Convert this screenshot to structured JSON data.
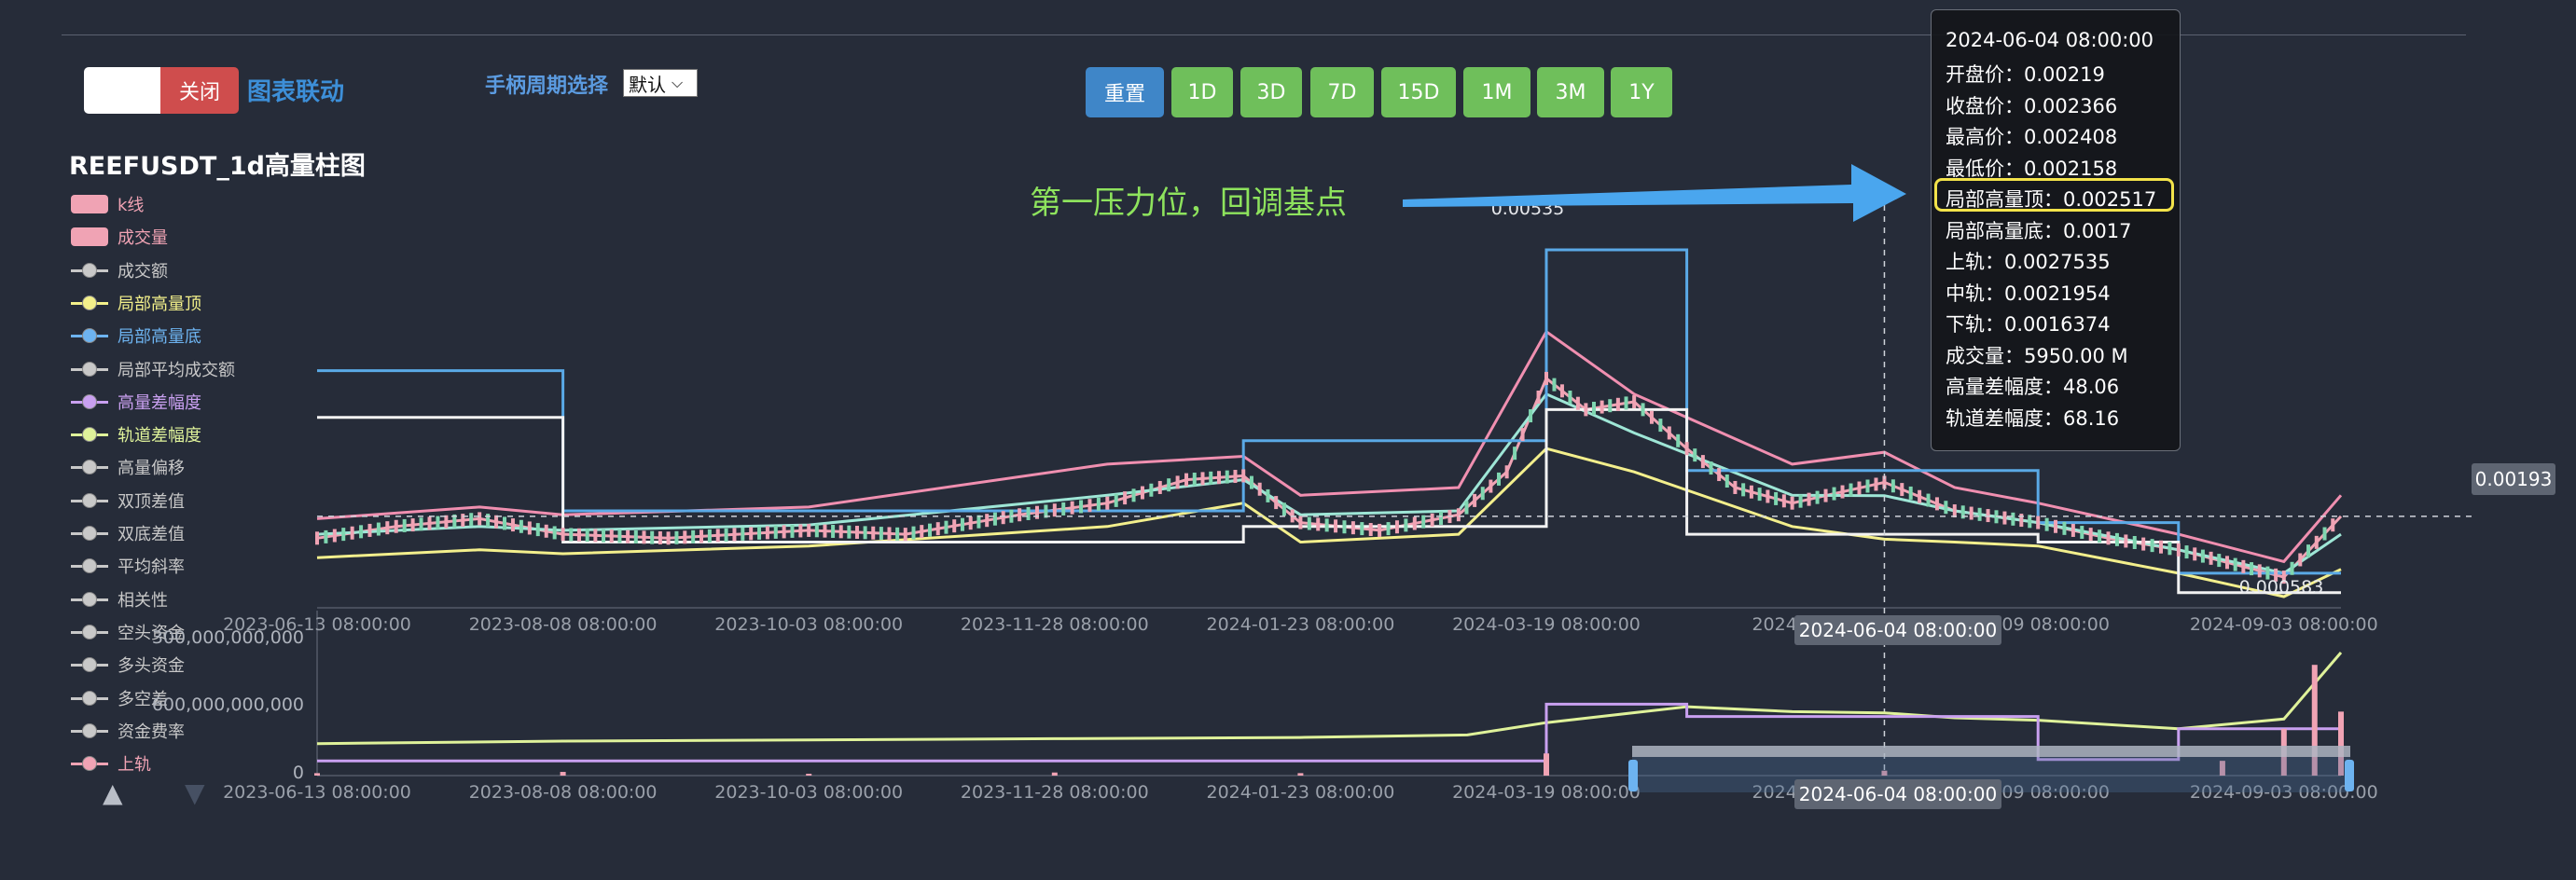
{
  "controls": {
    "toggle_off_label": "关闭",
    "link_label": "图表联动",
    "period_label": "手柄周期选择",
    "period_selected": "默认",
    "range_buttons": [
      "重置",
      "1D",
      "3D",
      "7D",
      "15D",
      "1M",
      "3M",
      "1Y"
    ]
  },
  "annotation": "第一压力位，回调基点",
  "chart_data": {
    "type": "line",
    "title": "REEFUSDT_1d高量柱图",
    "legend": [
      {
        "name": "k线",
        "color": "#f0a3b4",
        "symbol": "rect"
      },
      {
        "name": "成交量",
        "color": "#f0a3b4",
        "symbol": "rect"
      },
      {
        "name": "成交额",
        "color": "#c8c8c8",
        "symbol": "dot"
      },
      {
        "name": "局部高量顶",
        "color": "#f3f08a",
        "symbol": "dot"
      },
      {
        "name": "局部高量底",
        "color": "#6db3f0",
        "symbol": "dot"
      },
      {
        "name": "局部平均成交额",
        "color": "#c8c8c8",
        "symbol": "dot"
      },
      {
        "name": "高量差幅度",
        "color": "#c9a0f0",
        "symbol": "dot"
      },
      {
        "name": "轨道差幅度",
        "color": "#dff29a",
        "symbol": "dot"
      },
      {
        "name": "高量偏移",
        "color": "#c8c8c8",
        "symbol": "dot"
      },
      {
        "name": "双顶差值",
        "color": "#c8c8c8",
        "symbol": "dot"
      },
      {
        "name": "双底差值",
        "color": "#c8c8c8",
        "symbol": "dot"
      },
      {
        "name": "平均斜率",
        "color": "#c8c8c8",
        "symbol": "dot"
      },
      {
        "name": "相关性",
        "color": "#c8c8c8",
        "symbol": "dot"
      },
      {
        "name": "空头资金",
        "color": "#c8c8c8",
        "symbol": "dot"
      },
      {
        "name": "多头资金",
        "color": "#c8c8c8",
        "symbol": "dot"
      },
      {
        "name": "多空差",
        "color": "#c8c8c8",
        "symbol": "dot"
      },
      {
        "name": "资金费率",
        "color": "#c8c8c8",
        "symbol": "dot"
      },
      {
        "name": "上轨",
        "color": "#f0a3b4",
        "symbol": "dot"
      }
    ],
    "x_ticks": [
      "2023-06-13 08:00:00",
      "2023-08-08 08:00:00",
      "2023-10-03 08:00:00",
      "2023-11-28 08:00:00",
      "2024-01-23 08:00:00",
      "2024-03-19 08:00:00",
      "2024-05-14 08:00:00",
      "2024-07-09 08:00:00",
      "2024-09-03 08:00:00"
    ],
    "x_visible_labels": [
      "2023-06-13 08:00:00",
      "2023-08-08 08:00:00",
      "2023-10-03 08:00:00",
      "2023-11-28 08:00:00",
      "2024-01-23 08:00:00",
      "2024-03-19 08:00:00",
      "2024-05-",
      "-07-09 08:00:00",
      "2024-09-03 08:00:00"
    ],
    "xlim": [
      "2023-06-13",
      "2024-09-16"
    ],
    "ylim": [
      0.000583,
      0.00535
    ],
    "max_label": "0.00535",
    "min_label": "0.000583",
    "crosshair": {
      "x": "2024-06-04 08:00:00",
      "x_label": "2024-06-04 08:00:00",
      "y": 0.00193,
      "y_label": "0.00193"
    },
    "series": [
      {
        "name": "k线",
        "color": "#f0a3b4",
        "x": [
          "2023-06-13",
          "2023-07-01",
          "2023-07-20",
          "2023-08-08",
          "2023-09-01",
          "2023-10-03",
          "2023-10-25",
          "2023-11-20",
          "2023-12-10",
          "2023-12-28",
          "2024-01-10",
          "2024-01-23",
          "2024-02-10",
          "2024-02-28",
          "2024-03-10",
          "2024-03-19",
          "2024-03-28",
          "2024-04-08",
          "2024-04-20",
          "2024-05-01",
          "2024-05-14",
          "2024-06-04",
          "2024-06-20",
          "2024-07-09",
          "2024-07-25",
          "2024-08-10",
          "2024-09-03",
          "2024-09-16"
        ],
        "values": [
          0.00165,
          0.0018,
          0.0019,
          0.0017,
          0.00165,
          0.00175,
          0.0017,
          0.00195,
          0.0021,
          0.0024,
          0.00245,
          0.00185,
          0.00175,
          0.00195,
          0.0025,
          0.0037,
          0.0033,
          0.0034,
          0.0028,
          0.0023,
          0.0021,
          0.002366,
          0.002,
          0.00185,
          0.00165,
          0.0015,
          0.00115,
          0.00193
        ]
      },
      {
        "name": "上轨",
        "color": "#f08fb0",
        "x": [
          "2023-06-13",
          "2023-07-20",
          "2023-08-08",
          "2023-10-03",
          "2023-12-10",
          "2024-01-10",
          "2024-01-23",
          "2024-02-28",
          "2024-03-19",
          "2024-04-08",
          "2024-05-14",
          "2024-06-04",
          "2024-06-20",
          "2024-07-09",
          "2024-08-10",
          "2024-09-03",
          "2024-09-16"
        ],
        "values": [
          0.0019,
          0.00205,
          0.00195,
          0.00205,
          0.0026,
          0.0027,
          0.0022,
          0.0023,
          0.0043,
          0.0035,
          0.0026,
          0.0027535,
          0.0023,
          0.0021,
          0.0017,
          0.00135,
          0.0022
        ]
      },
      {
        "name": "中轨",
        "color": "#9ee6d6",
        "x": [
          "2023-06-13",
          "2023-07-20",
          "2023-08-08",
          "2023-10-03",
          "2023-12-10",
          "2024-01-10",
          "2024-01-23",
          "2024-02-28",
          "2024-03-19",
          "2024-04-08",
          "2024-05-14",
          "2024-06-04",
          "2024-06-20",
          "2024-07-09",
          "2024-08-10",
          "2024-09-03",
          "2024-09-16"
        ],
        "values": [
          0.0017,
          0.0018,
          0.00175,
          0.00182,
          0.0022,
          0.0024,
          0.00195,
          0.002,
          0.0035,
          0.003,
          0.0022,
          0.0021954,
          0.002,
          0.00185,
          0.0015,
          0.0012,
          0.0017
        ]
      },
      {
        "name": "下轨",
        "color": "#f3ef8c",
        "x": [
          "2023-06-13",
          "2023-07-20",
          "2023-08-08",
          "2023-10-03",
          "2023-12-10",
          "2024-01-10",
          "2024-01-23",
          "2024-02-28",
          "2024-03-19",
          "2024-04-08",
          "2024-05-14",
          "2024-06-04",
          "2024-06-20",
          "2024-07-09",
          "2024-08-10",
          "2024-09-03",
          "2024-09-16"
        ],
        "values": [
          0.0014,
          0.0015,
          0.00145,
          0.00155,
          0.0018,
          0.0021,
          0.0016,
          0.0017,
          0.0028,
          0.0025,
          0.0018,
          0.0016374,
          0.0016,
          0.00155,
          0.0012,
          0.0009,
          0.00125
        ]
      },
      {
        "name": "局部高量顶",
        "color": "#5aa9e6",
        "step": true,
        "x": [
          "2023-06-13",
          "2023-08-08",
          "2023-08-08",
          "2024-01-10",
          "2024-01-10",
          "2024-03-19",
          "2024-03-19",
          "2024-04-20",
          "2024-04-20",
          "2024-07-09",
          "2024-07-09",
          "2024-08-10",
          "2024-08-10",
          "2024-09-16"
        ],
        "values": [
          0.0038,
          0.0038,
          0.002,
          0.002,
          0.0029,
          0.0029,
          0.00535,
          0.00535,
          0.002517,
          0.002517,
          0.00185,
          0.00185,
          0.0012,
          0.0012
        ]
      },
      {
        "name": "局部高量底",
        "color": "#f2f2f2",
        "step": true,
        "x": [
          "2023-06-13",
          "2023-08-08",
          "2023-08-08",
          "2024-01-10",
          "2024-01-10",
          "2024-03-19",
          "2024-03-19",
          "2024-04-20",
          "2024-04-20",
          "2024-07-09",
          "2024-07-09",
          "2024-08-10",
          "2024-08-10",
          "2024-09-16"
        ],
        "values": [
          0.0032,
          0.0032,
          0.0016,
          0.0016,
          0.0018,
          0.0018,
          0.0033,
          0.0033,
          0.0017,
          0.0017,
          0.0016,
          0.0016,
          0.00095,
          0.00095
        ]
      }
    ],
    "lower_panel": {
      "y_tick_labels": [
        "300,000,000,000",
        "600,000,000,000",
        "0"
      ],
      "ylim": [
        0,
        1000
      ],
      "series": [
        {
          "name": "轨道差幅度",
          "color": "#dff29a",
          "x": [
            "2023-06-13",
            "2023-08-08",
            "2023-10-03",
            "2023-11-28",
            "2024-01-23",
            "2024-03-01",
            "2024-03-19",
            "2024-04-20",
            "2024-05-14",
            "2024-06-04",
            "2024-06-20",
            "2024-07-09",
            "2024-08-10",
            "2024-09-03",
            "2024-09-16"
          ],
          "values": [
            260,
            280,
            290,
            300,
            310,
            330,
            430,
            560,
            520,
            510,
            470,
            450,
            380,
            460,
            1000
          ]
        },
        {
          "name": "高量差幅度",
          "color": "#c9a0f0",
          "step": true,
          "x": [
            "2023-06-13",
            "2024-03-19",
            "2024-03-19",
            "2024-04-20",
            "2024-04-20",
            "2024-07-09",
            "2024-07-09",
            "2024-08-10",
            "2024-08-10",
            "2024-09-16"
          ],
          "values": [
            120,
            120,
            580,
            580,
            480,
            480,
            130,
            130,
            380,
            380
          ]
        },
        {
          "name": "成交量",
          "color": "#f0a3b4",
          "type": "bar",
          "x": [
            "2023-06-13",
            "2023-08-08",
            "2023-10-03",
            "2023-11-28",
            "2024-01-23",
            "2024-03-19",
            "2024-06-04",
            "2024-08-20",
            "2024-09-03",
            "2024-09-10",
            "2024-09-16"
          ],
          "values": [
            20,
            30,
            15,
            25,
            20,
            180,
            40,
            120,
            380,
            900,
            520
          ]
        }
      ]
    }
  },
  "tooltip": {
    "date": "2024-06-04 08:00:00",
    "rows": [
      "开盘价：0.00219",
      "收盘价：0.002366",
      "最高价：0.002408",
      "最低价：0.002158",
      "局部高量顶：0.002517",
      "局部高量底：0.0017",
      "上轨：0.0027535",
      "中轨：0.0021954",
      "下轨：0.0016374",
      "成交量：5950.00 M",
      "高量差幅度：48.06",
      "轨道差幅度：68.16"
    ]
  },
  "colors": {
    "background": "#262c39",
    "reset_button": "#3f86c8",
    "range_button": "#6fbf5b",
    "annotation": "#8ee35d",
    "arrow": "#4aa6ee",
    "highlight": "#f3e34a"
  }
}
